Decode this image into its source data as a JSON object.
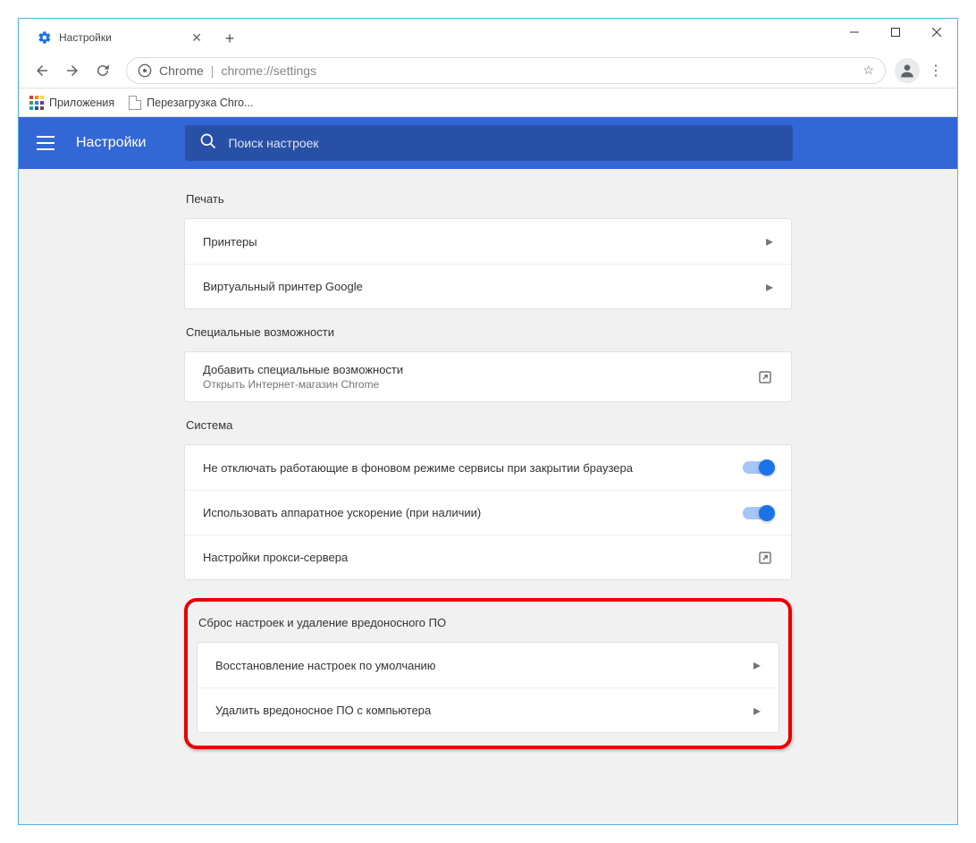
{
  "tab": {
    "title": "Настройки"
  },
  "omnibox": {
    "prefix": "Chrome",
    "url": "chrome://settings"
  },
  "bookmarks": {
    "apps": "Приложения",
    "item1": "Перезагрузка Chro..."
  },
  "header": {
    "title": "Настройки",
    "search_placeholder": "Поиск настроек"
  },
  "sections": {
    "print": {
      "title": "Печать",
      "rows": {
        "printers": "Принтеры",
        "cloud_print": "Виртуальный принтер Google"
      }
    },
    "a11y": {
      "title": "Специальные возможности",
      "row_title": "Добавить специальные возможности",
      "row_sub": "Открыть Интернет-магазин Chrome"
    },
    "system": {
      "title": "Система",
      "bg": "Не отключать работающие в фоновом режиме сервисы при закрытии браузера",
      "hw": "Использовать аппаратное ускорение (при наличии)",
      "proxy": "Настройки прокси-сервера"
    },
    "reset": {
      "title": "Сброс настроек и удаление вредоносного ПО",
      "restore": "Восстановление настроек по умолчанию",
      "cleanup": "Удалить вредоносное ПО с компьютера"
    }
  }
}
